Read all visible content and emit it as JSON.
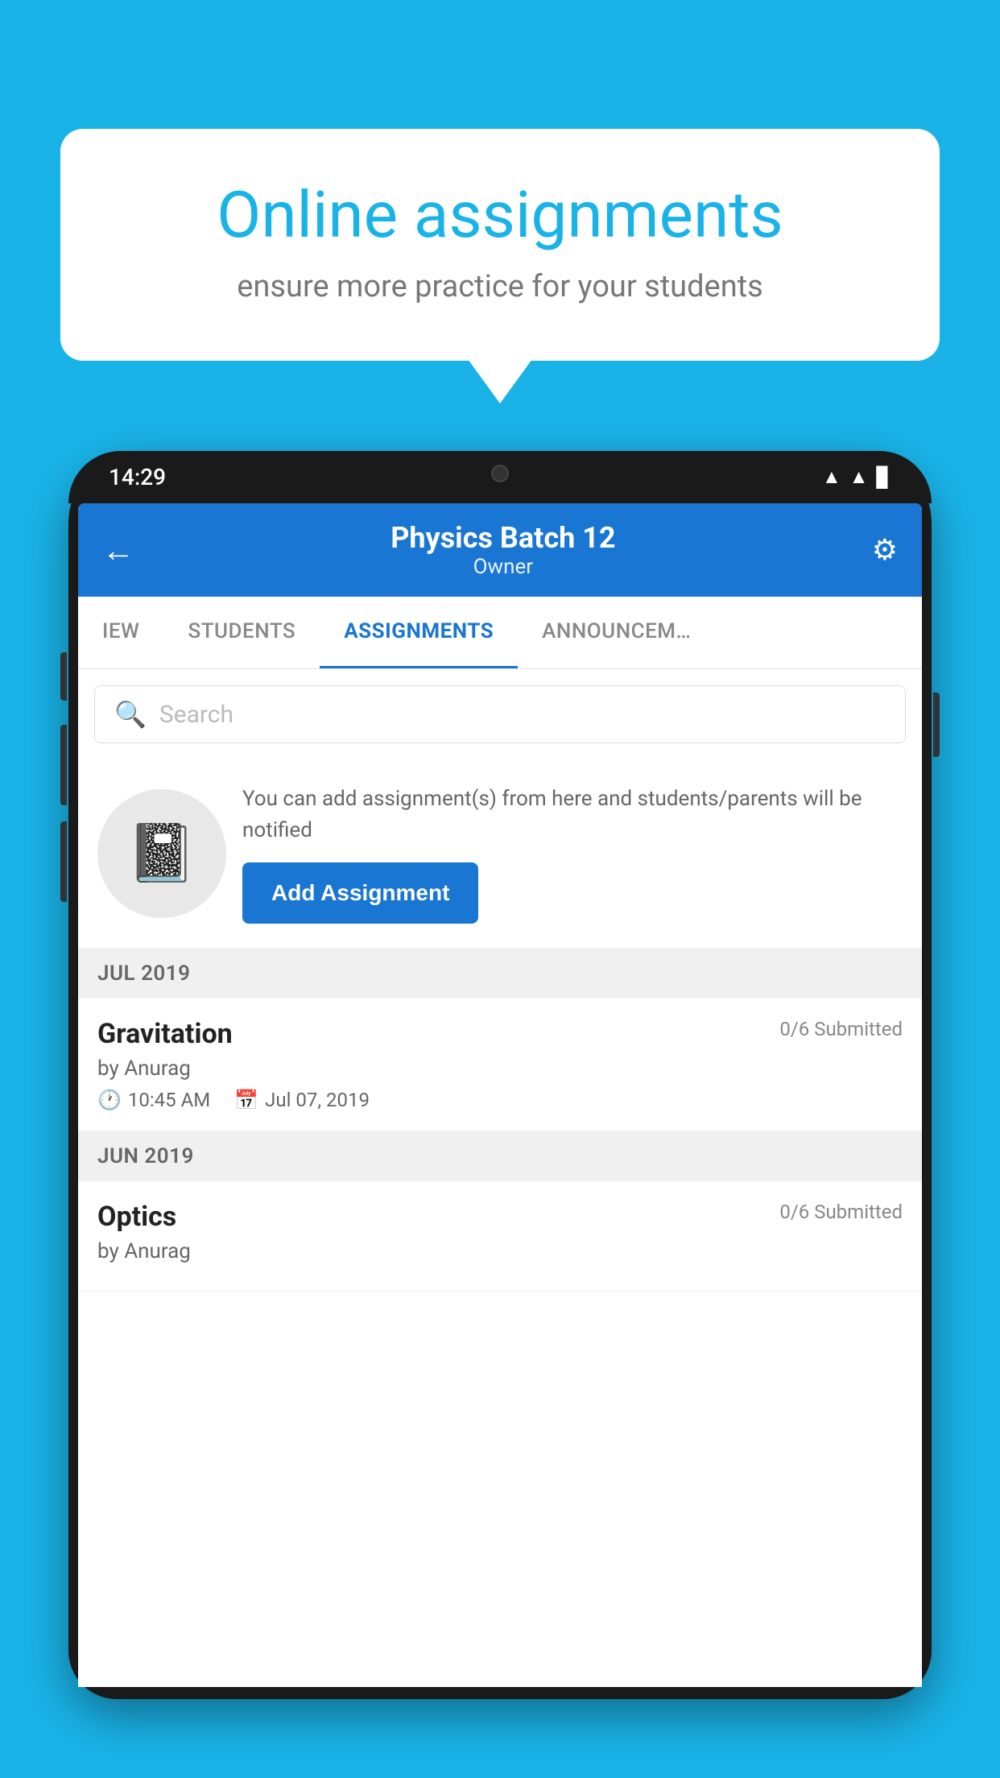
{
  "background": {
    "color": "#1ab3e8"
  },
  "speech_bubble": {
    "title": "Online assignments",
    "subtitle": "ensure more practice for your students"
  },
  "phone": {
    "status_bar": {
      "time": "14:29"
    },
    "header": {
      "title": "Physics Batch 12",
      "subtitle": "Owner",
      "back_label": "←",
      "settings_label": "⚙"
    },
    "tabs": [
      {
        "label": "IEW",
        "active": false
      },
      {
        "label": "STUDENTS",
        "active": false
      },
      {
        "label": "ASSIGNMENTS",
        "active": true
      },
      {
        "label": "ANNOUNCEM…",
        "active": false
      }
    ],
    "search": {
      "placeholder": "Search"
    },
    "promo": {
      "description": "You can add assignment(s) from here and students/parents will be notified",
      "button_label": "Add Assignment"
    },
    "sections": [
      {
        "header": "JUL 2019",
        "assignments": [
          {
            "title": "Gravitation",
            "submitted": "0/6 Submitted",
            "author": "by Anurag",
            "time": "10:45 AM",
            "date": "Jul 07, 2019"
          }
        ]
      },
      {
        "header": "JUN 2019",
        "assignments": [
          {
            "title": "Optics",
            "submitted": "0/6 Submitted",
            "author": "by Anurag",
            "time": "",
            "date": ""
          }
        ]
      }
    ]
  }
}
